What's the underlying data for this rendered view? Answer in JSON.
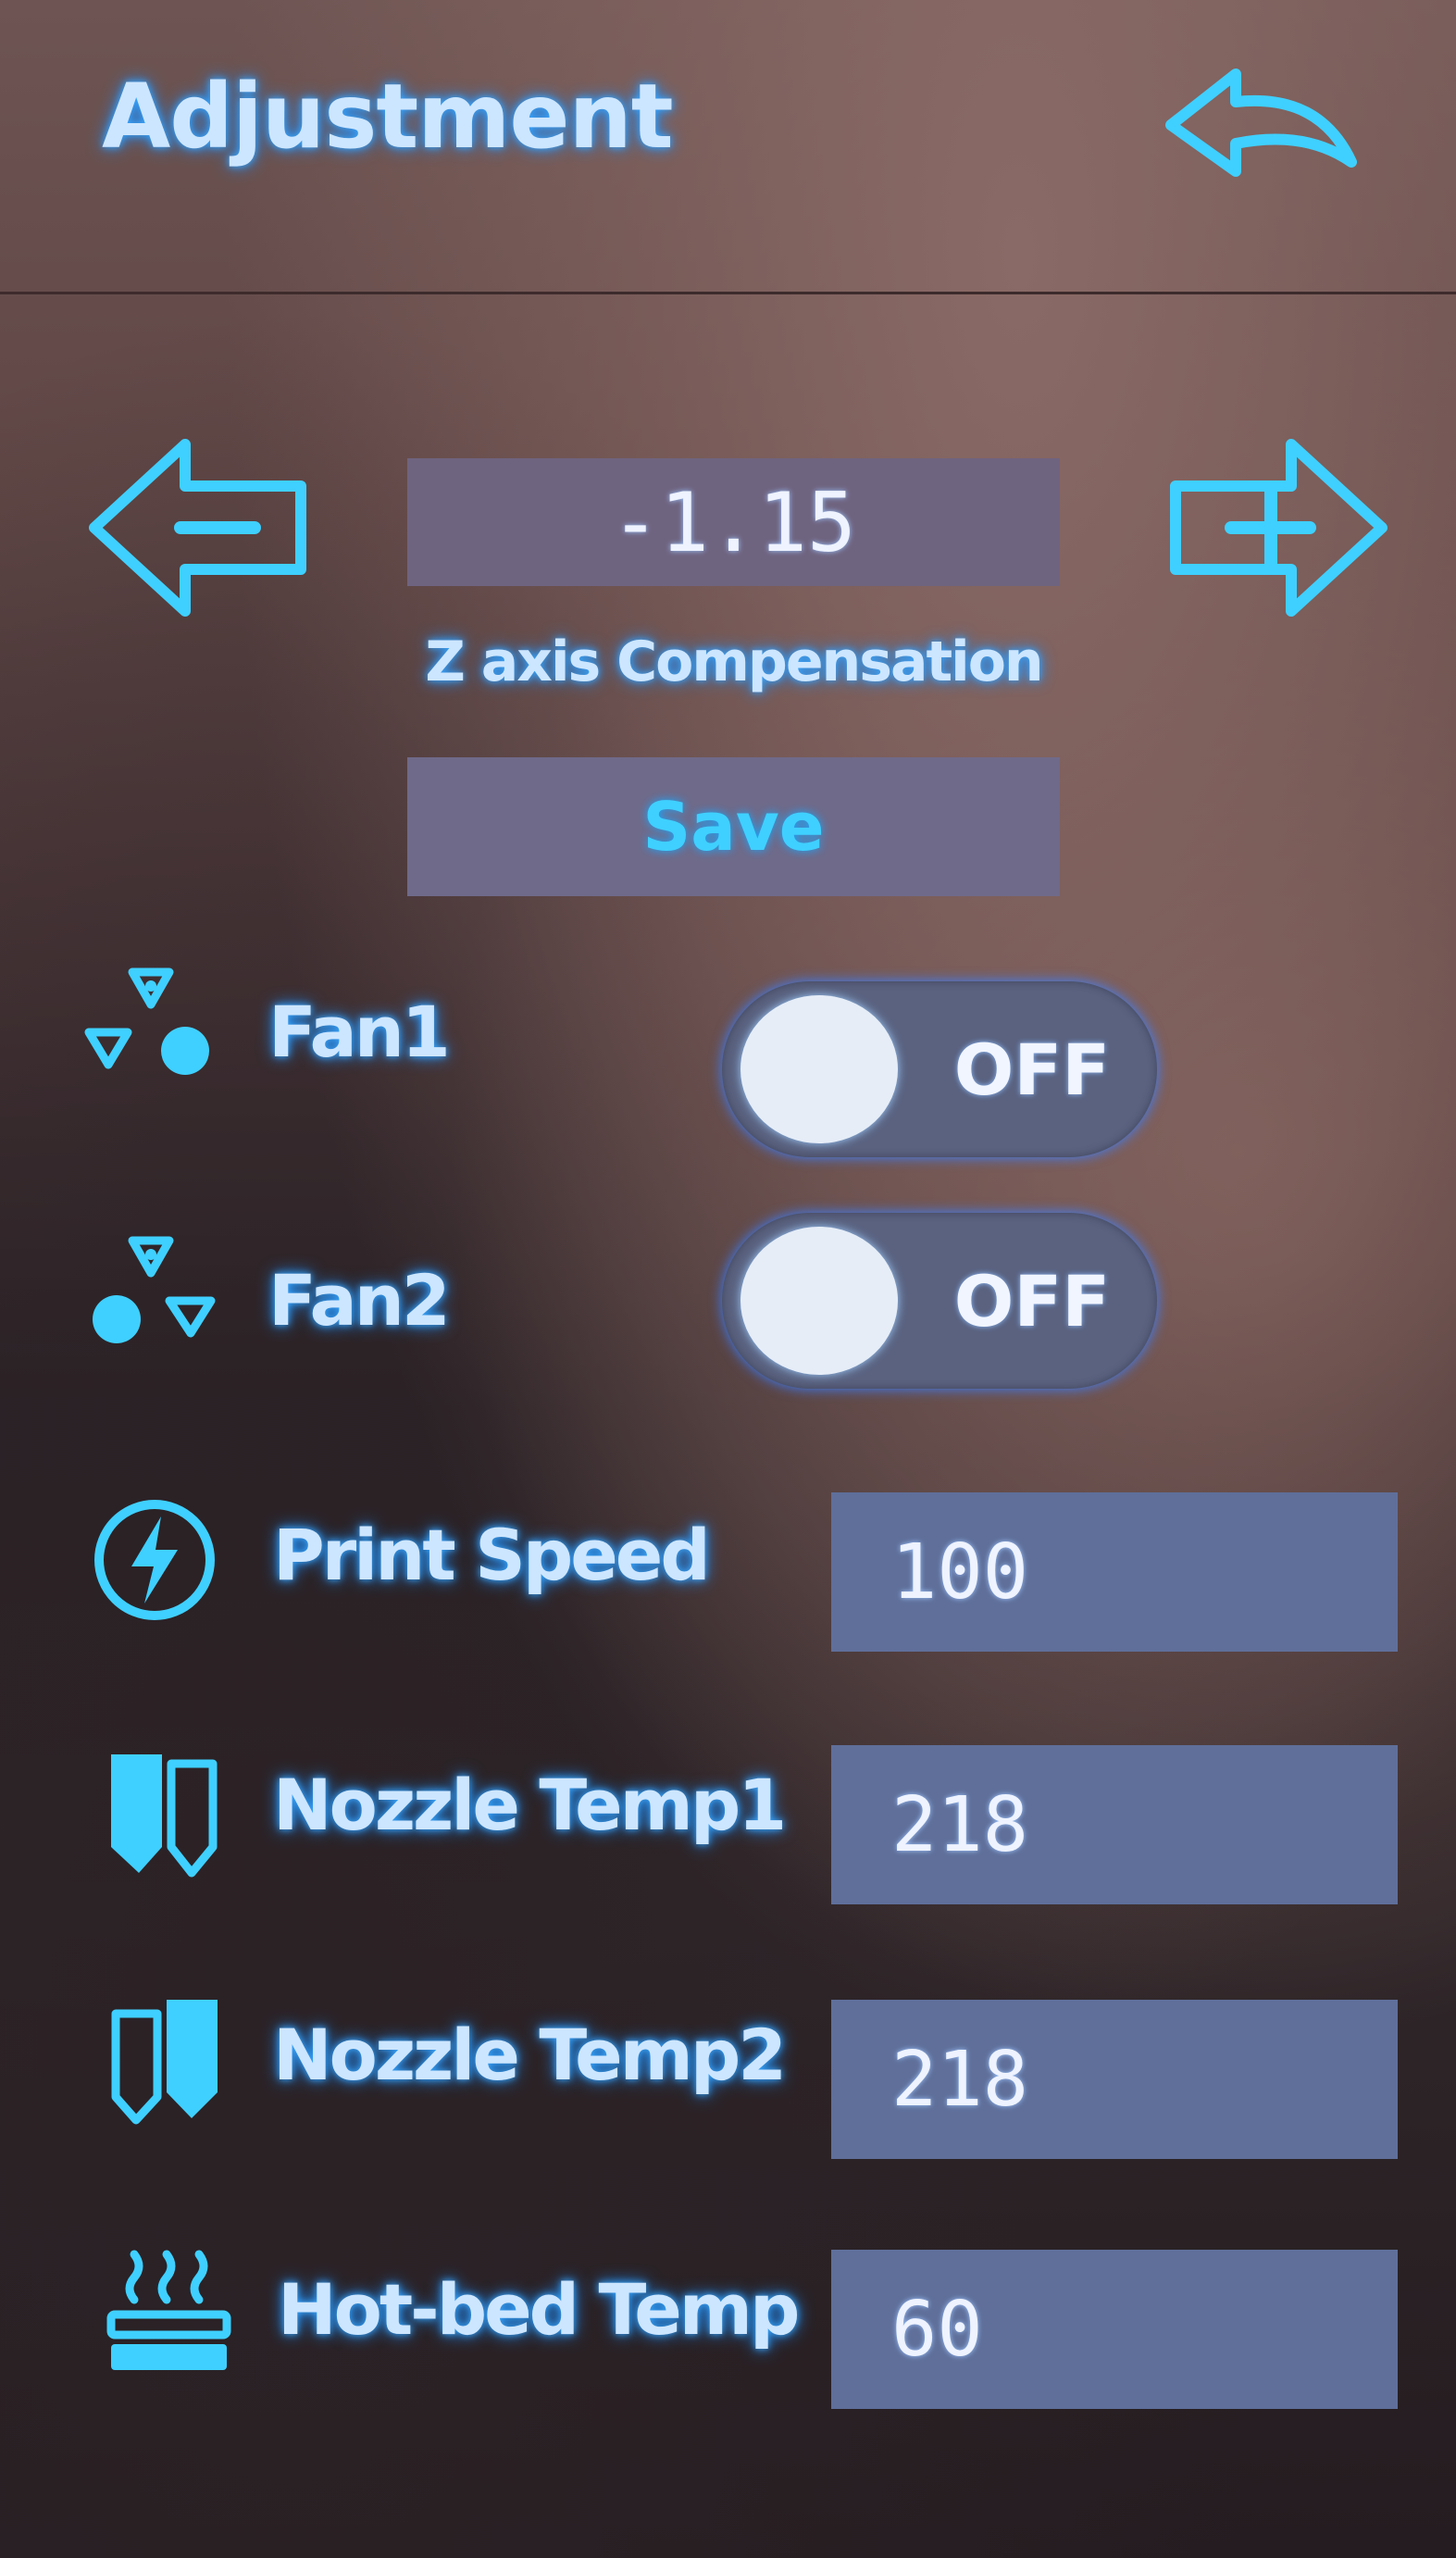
{
  "header": {
    "title": "Adjustment",
    "back_icon": "back-arrow-icon"
  },
  "z_compensation": {
    "value": "-1.15",
    "label": "Z axis Compensation",
    "decrease_icon": "minus-arrow-icon",
    "increase_icon": "plus-arrow-icon",
    "save_label": "Save"
  },
  "fans": [
    {
      "label": "Fan1",
      "state": "OFF",
      "icon": "fan-icon"
    },
    {
      "label": "Fan2",
      "state": "OFF",
      "icon": "fan-icon"
    }
  ],
  "settings": [
    {
      "label": "Print Speed",
      "value": "100",
      "icon": "speed-icon"
    },
    {
      "label": "Nozzle Temp1",
      "value": "218",
      "icon": "nozzle-icon"
    },
    {
      "label": "Nozzle Temp2",
      "value": "218",
      "icon": "nozzle-icon"
    },
    {
      "label": "Hot-bed Temp",
      "value": "60",
      "icon": "hotbed-icon"
    }
  ],
  "colors": {
    "accent": "#3fd0ff",
    "label_glow": "#cde6ff",
    "field_bg": "#5f6f9a"
  }
}
